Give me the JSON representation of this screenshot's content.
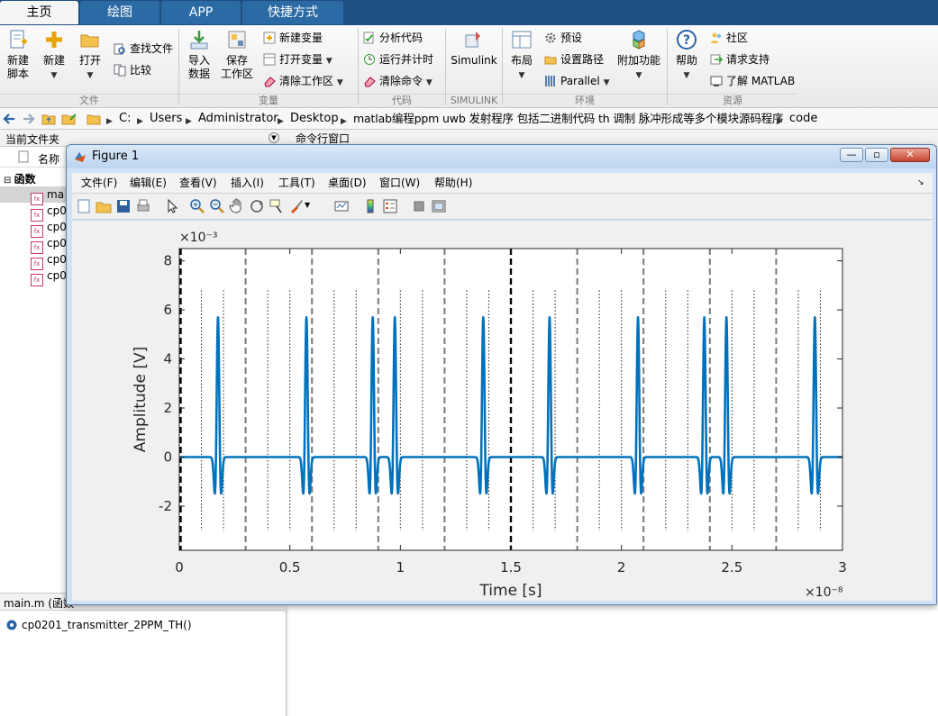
{
  "tabs": [
    "主页",
    "绘图",
    "APP",
    "快捷方式"
  ],
  "ribbon": {
    "new_script": "新建\n脚本",
    "new": "新建",
    "open": "打开",
    "find_files": "查找文件",
    "compare": "比较",
    "import_data": "导入\n数据",
    "save_workspace": "保存\n工作区",
    "new_variable": "新建变量",
    "open_variable": "打开变量",
    "clear_workspace": "清除工作区",
    "analyze_code": "分析代码",
    "run_and_time": "运行并计时",
    "clear_commands": "清除命令",
    "simulink": "Simulink",
    "layout": "布局",
    "preferences": "预设",
    "set_path": "设置路径",
    "parallel": "Parallel",
    "addons": "附加功能",
    "help": "帮助",
    "community": "社区",
    "request_support": "请求支持",
    "learn_matlab": "了解 MATLAB",
    "groups": [
      "文件",
      "变量",
      "代码",
      "SIMULINK",
      "环境",
      "资源"
    ]
  },
  "address": {
    "crumbs": [
      "C:",
      "Users",
      "Administrator",
      "Desktop",
      "matlab编程ppm uwb 发射程序 包括二进制代码 th 调制 脉冲形成等多个模块源码程序",
      "code"
    ]
  },
  "current_folder": {
    "title": "当前文件夹",
    "column_name": "名称",
    "group": "函数",
    "files": [
      "ma",
      "cp0",
      "cp0",
      "cp0",
      "cp0",
      "cp0"
    ],
    "details_label": "main.m  (函数",
    "details_item": "cp0201_transmitter_2PPM_TH()"
  },
  "command_window": {
    "title": "命令行窗口"
  },
  "figure": {
    "title": "Figure 1",
    "menu": [
      "文件(F)",
      "编辑(E)",
      "查看(V)",
      "插入(I)",
      "工具(T)",
      "桌面(D)",
      "窗口(W)",
      "帮助(H)"
    ]
  },
  "chart_data": {
    "type": "line",
    "xlabel": "Time [s]",
    "ylabel": "Amplitude [V]",
    "x_exponent_label": "×10⁻⁸",
    "y_exponent_label": "×10⁻³",
    "xlim": [
      0,
      3
    ],
    "ylim": [
      -3.8,
      8.5
    ],
    "x_ticks": [
      0,
      0.5,
      1,
      1.5,
      2,
      2.5,
      3
    ],
    "x_tick_labels": [
      "0",
      "0.5",
      "1",
      "1.5",
      "2",
      "2.5",
      "3"
    ],
    "y_ticks": [
      -2,
      0,
      2,
      4,
      6,
      8
    ],
    "y_tick_labels": [
      "-2",
      "0",
      "2",
      "4",
      "6",
      "8"
    ],
    "pulse_peak": 5.7,
    "pulse_min": -2.5,
    "pulse_centers": [
      0.175,
      0.575,
      0.875,
      0.975,
      1.375,
      1.675,
      2.075,
      2.375,
      2.475,
      2.875
    ],
    "frame_lines": [
      0,
      1.5
    ],
    "slot_lines": [
      0.3,
      0.6,
      0.9,
      1.2,
      1.8,
      2.1,
      2.4,
      2.7
    ],
    "chip_lines": [
      0.1,
      0.2,
      0.4,
      0.5,
      0.7,
      0.8,
      1.0,
      1.1,
      1.3,
      1.4,
      1.6,
      1.7,
      1.9,
      2.0,
      2.2,
      2.3,
      2.5,
      2.6,
      2.8,
      2.9
    ],
    "line_color": "#0072bd"
  }
}
